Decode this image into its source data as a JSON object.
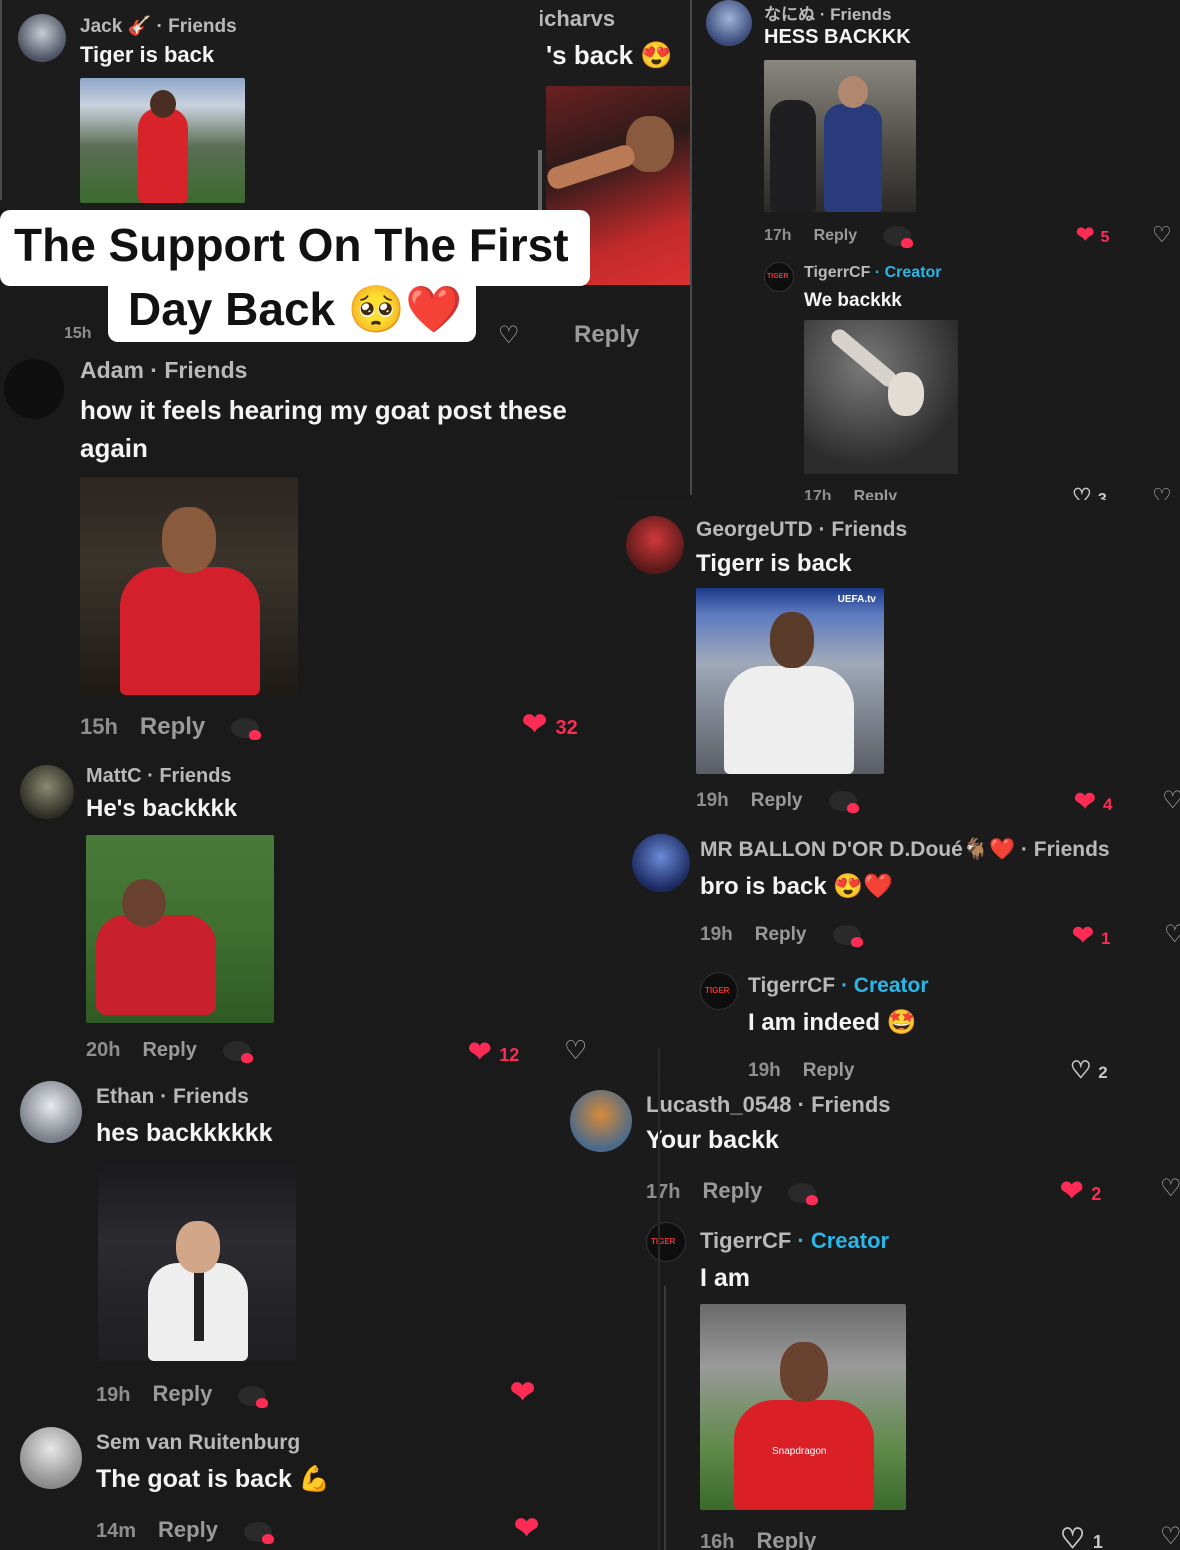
{
  "headline": {
    "line1": "The Support On The First",
    "line2": "Day Back 🥺❤️"
  },
  "comments": {
    "jack": {
      "name": "Jack 🎸 · Friends",
      "text": "Tiger is back",
      "cut_label": "Firs",
      "time": "15h"
    },
    "charvs": {
      "name": "icharvs",
      "text": "'s back 😍",
      "reply": "Reply"
    },
    "nanu": {
      "name": "なにぬ · Friends",
      "text": "HESS BACKKK",
      "time": "17h",
      "reply": "Reply",
      "likes": "5"
    },
    "tiger1": {
      "name": "TigerrCF",
      "role": "· Creator",
      "text": "We backkk",
      "time": "17h",
      "reply": "Reply",
      "likes": "3"
    },
    "adam": {
      "name": "Adam · Friends",
      "text1": "how it feels hearing my goat post these",
      "text2": "again",
      "time": "15h",
      "reply": "Reply",
      "likes": "32"
    },
    "george": {
      "name": "GeorgeUTD · Friends",
      "text": "Tigerr is back",
      "time": "19h",
      "reply": "Reply",
      "likes": "4",
      "img_label": "UEFA.tv"
    },
    "mattc": {
      "name": "MattC · Friends",
      "text": "He's backkkk",
      "time": "20h",
      "reply": "Reply",
      "likes": "12"
    },
    "ballon": {
      "name": "MR BALLON D'OR D.Doué🐐❤️ · Friends",
      "text": "bro is back 😍❤️",
      "time": "19h",
      "reply": "Reply",
      "likes": "1"
    },
    "tiger2": {
      "name": "TigerrCF",
      "role": "· Creator",
      "text": "I am indeed 🤩",
      "time": "19h",
      "reply": "Reply",
      "likes": "2"
    },
    "ethan": {
      "name": "Ethan · Friends",
      "text": "hes backkkkkk",
      "time": "19h",
      "reply": "Reply"
    },
    "lucas": {
      "name": "Lucasth_0548 · Friends",
      "text": "Your backk",
      "time": "17h",
      "reply": "Reply",
      "likes": "2"
    },
    "tiger3": {
      "name": "TigerrCF",
      "role": "· Creator",
      "text": "I am",
      "time": "16h",
      "reply": "Reply",
      "likes": "1",
      "img_label": "Snapdragon"
    },
    "sem": {
      "name": "Sem van Ruitenburg",
      "text": "The goat is back 💪",
      "time": "14m",
      "reply": "Reply"
    }
  },
  "avatar_label": "TIGER",
  "colors": {
    "like_red": "#fe2c55",
    "creator_blue": "#2ab6e6",
    "background": "#161616"
  }
}
